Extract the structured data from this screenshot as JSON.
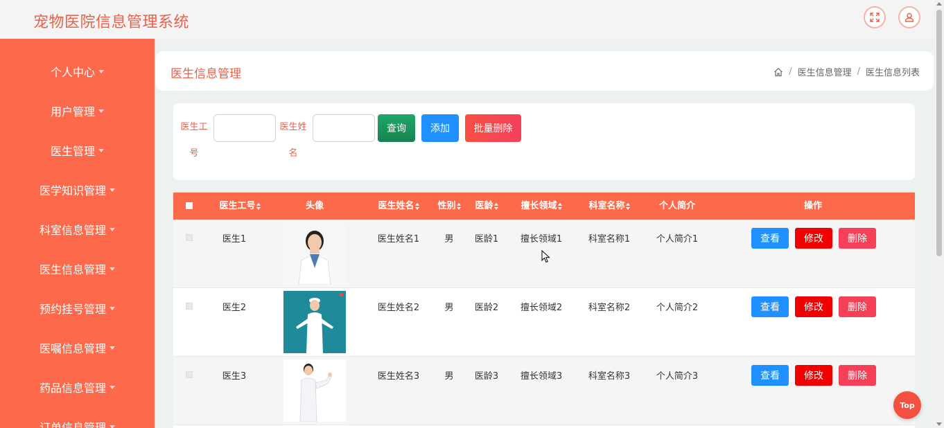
{
  "app": {
    "title": "宠物医院信息管理系统"
  },
  "header": {
    "fullscreen_icon": "expand-icon",
    "user_icon": "user-icon"
  },
  "sidebar": {
    "items": [
      {
        "label": "个人中心"
      },
      {
        "label": "用户管理"
      },
      {
        "label": "医生管理"
      },
      {
        "label": "医学知识管理"
      },
      {
        "label": "科室信息管理"
      },
      {
        "label": "医生信息管理"
      },
      {
        "label": "预约挂号管理"
      },
      {
        "label": "医嘱信息管理"
      },
      {
        "label": "药品信息管理"
      },
      {
        "label": "订单信息管理"
      }
    ]
  },
  "page": {
    "title": "医生信息管理"
  },
  "breadcrumb": {
    "home_icon": "home-icon",
    "level1": "医生信息管理",
    "level2": "医生信息列表",
    "separator": "/"
  },
  "search": {
    "doctor_no_label": "医生工号",
    "doctor_no_value": "",
    "doctor_name_label": "医生姓名",
    "doctor_name_value": "",
    "query_label": "查询",
    "add_label": "添加",
    "batch_delete_label": "批量删除"
  },
  "table": {
    "columns": [
      "医生工号",
      "头像",
      "医生姓名",
      "性别",
      "医龄",
      "擅长领域",
      "科室名称",
      "个人简介",
      "操作"
    ],
    "rows": [
      {
        "doctor_no": "医生1",
        "name": "医生姓名1",
        "gender": "男",
        "seniority": "医龄1",
        "specialty": "擅长领域1",
        "department": "科室名称1",
        "intro": "个人简介1"
      },
      {
        "doctor_no": "医生2",
        "name": "医生姓名2",
        "gender": "男",
        "seniority": "医龄2",
        "specialty": "擅长领域2",
        "department": "科室名称2",
        "intro": "个人简介2"
      },
      {
        "doctor_no": "医生3",
        "name": "医生姓名3",
        "gender": "男",
        "seniority": "医龄3",
        "specialty": "擅长领域3",
        "department": "科室名称3",
        "intro": "个人简介3"
      }
    ],
    "actions": {
      "view": "查看",
      "edit": "修改",
      "delete": "删除"
    }
  },
  "back_to_top": "Top",
  "colors": {
    "accent": "#fd6a4b",
    "title": "#e8614a",
    "query": "#1b9e5c",
    "add": "#1e90ff",
    "edit": "#f10000",
    "delete": "#f54058"
  }
}
